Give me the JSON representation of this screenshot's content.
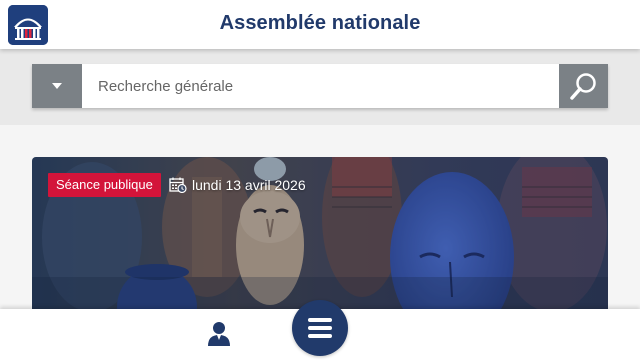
{
  "header": {
    "title": "Assemblée nationale",
    "logo_icon": "hemicycle-logo-icon"
  },
  "search": {
    "placeholder": "Recherche générale",
    "value": "",
    "scope_icon": "caret-down-icon",
    "submit_icon": "magnifier-icon"
  },
  "card": {
    "badge": "Séance publique",
    "date": "lundi 13 avril 2026",
    "date_icon": "calendar-clock-icon",
    "image": "carved-masks-photo"
  },
  "bottom_nav": {
    "user_icon": "user-icon",
    "menu_icon": "hamburger-menu-icon"
  },
  "colors": {
    "brand_navy": "#213a6b",
    "badge_red": "#d3143a",
    "search_button_gray": "#7b8186",
    "logo_blue": "#1f3f7d"
  }
}
